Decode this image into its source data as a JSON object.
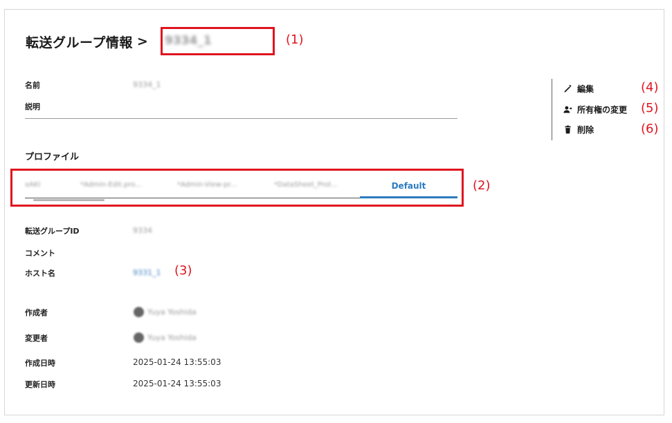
{
  "header": {
    "title": "転送グループ情報",
    "separator": ">",
    "group_id_display": "9334_1"
  },
  "basic": {
    "name_label": "名前",
    "name_value": "9334_1",
    "description_label": "説明"
  },
  "profiles": {
    "section_title": "プロファイル",
    "tabs": [
      {
        "label": "xAKI"
      },
      {
        "label": "*Admin-Edit.pro..."
      },
      {
        "label": "*Admin-View-pr..."
      },
      {
        "label": "*DataSheet_Prot..."
      },
      {
        "label": "Default"
      }
    ]
  },
  "details": {
    "transfer_group_id_label": "転送グループID",
    "transfer_group_id_value": "9334",
    "comment_label": "コメント",
    "host_name_label": "ホスト名",
    "host_name_value": "9331_1",
    "creator_label": "作成者",
    "creator_value": "Yuya Yoshida",
    "modifier_label": "変更者",
    "modifier_value": "Yuya Yoshida",
    "created_at_label": "作成日時",
    "created_at_value": "2025-01-24 13:55:03",
    "updated_at_label": "更新日時",
    "updated_at_value": "2025-01-24 13:55:03"
  },
  "actions": {
    "edit_label": "編集",
    "change_owner_label": "所有権の変更",
    "delete_label": "削除"
  },
  "annotations": {
    "a1": "(1)",
    "a2": "(2)",
    "a3": "(3)",
    "a4": "(4)",
    "a5": "(5)",
    "a6": "(6)"
  },
  "colors": {
    "accent": "#2c7bc0",
    "annotation_red": "#e0141e"
  }
}
